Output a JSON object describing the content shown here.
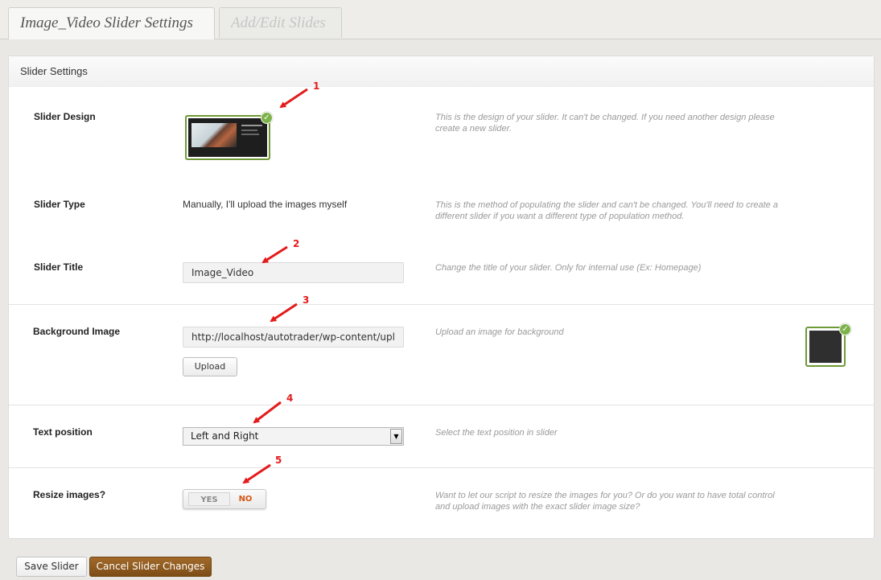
{
  "tabs": [
    {
      "label": "Image_Video Slider Settings",
      "active": true
    },
    {
      "label": "Add/Edit Slides",
      "active": false
    }
  ],
  "panel": {
    "title": "Slider Settings"
  },
  "rows": {
    "design": {
      "label": "Slider Design",
      "description": "This is the design of your slider. It can't be changed. If you need another design please create a new slider."
    },
    "type": {
      "label": "Slider Type",
      "value": "Manually, I'll upload the images myself",
      "description": "This is the method of populating the slider and can't be changed. You'll need to create a different slider if you want a different type of population method."
    },
    "title": {
      "label": "Slider Title",
      "value": "Image_Video",
      "description": "Change the title of your slider. Only for internal use (Ex: Homepage)"
    },
    "background": {
      "label": "Background Image",
      "value": "http://localhost/autotrader/wp-content/upl",
      "upload_label": "Upload",
      "description": "Upload an image for background"
    },
    "text_position": {
      "label": "Text position",
      "value": "Left and Right",
      "description": "Select the text position in slider"
    },
    "resize": {
      "label": "Resize images?",
      "yes_label": "YES",
      "no_label": "NO",
      "selected": "NO",
      "description": "Want to let our script to resize the images for you? Or do you want to have total control and upload images with the exact slider image size?"
    }
  },
  "annotations": [
    "1",
    "2",
    "3",
    "4",
    "5"
  ],
  "colors": {
    "annotation": "#e31b1b",
    "selected_border": "#6f9a37",
    "cancel_button": "#8a5a1f"
  },
  "footer": {
    "save_label": "Save Slider",
    "cancel_label": "Cancel Slider Changes"
  }
}
